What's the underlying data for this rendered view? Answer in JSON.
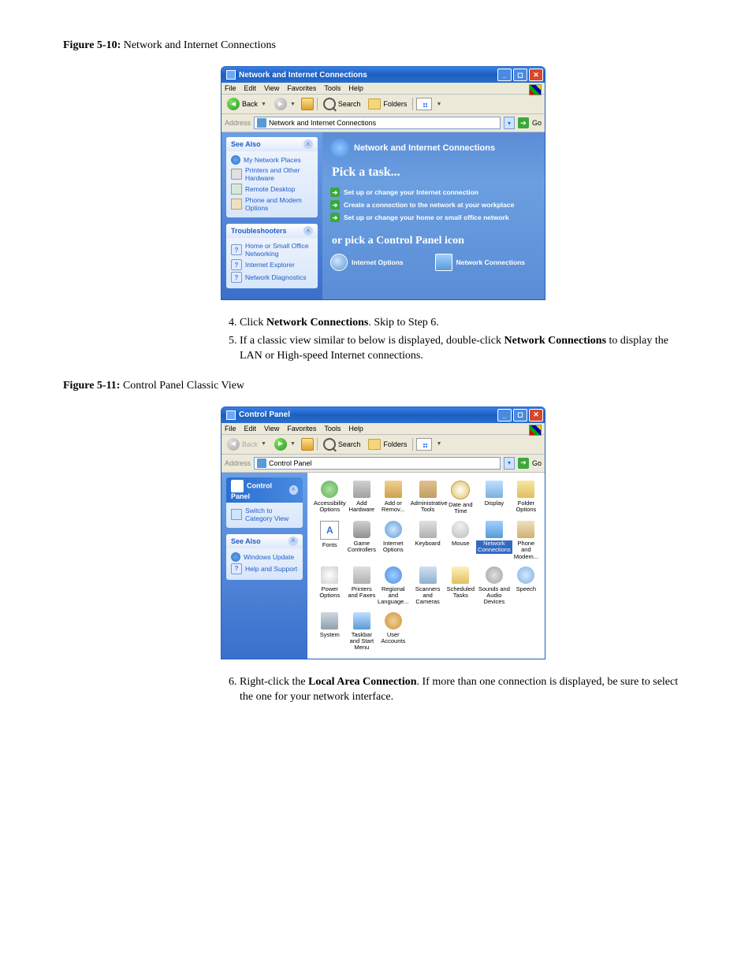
{
  "figure1": {
    "caption_label": "Figure 5-10:",
    "caption_text": " Network and Internet Connections",
    "window_title": "Network and Internet Connections",
    "menu": [
      "File",
      "Edit",
      "View",
      "Favorites",
      "Tools",
      "Help"
    ],
    "toolbar": {
      "back": "Back",
      "search": "Search",
      "folders": "Folders"
    },
    "address": {
      "label": "Address",
      "value": "Network and Internet Connections",
      "go": "Go"
    },
    "side": {
      "see_also": {
        "title": "See Also",
        "items": [
          "My Network Places",
          "Printers and Other Hardware",
          "Remote Desktop",
          "Phone and Modem Options"
        ]
      },
      "troubleshooters": {
        "title": "Troubleshooters",
        "items": [
          "Home or Small Office Networking",
          "Internet Explorer",
          "Network Diagnostics"
        ]
      }
    },
    "main": {
      "category_title": "Network and Internet Connections",
      "pick_task": "Pick a task...",
      "tasks": [
        "Set up or change your Internet connection",
        "Create a connection to the network at your workplace",
        "Set up or change your home or small office network"
      ],
      "or_pick": "or pick a Control Panel icon",
      "icons": [
        "Internet Options",
        "Network Connections"
      ]
    }
  },
  "stepsA": {
    "s4_prefix": "Click ",
    "s4_bold": "Network Connections",
    "s4_suffix": ". Skip to Step 6.",
    "s5_prefix": "If a classic view similar to below is displayed, double-click ",
    "s5_bold": "Network Connections",
    "s5_suffix": " to display the LAN or High-speed Internet connections."
  },
  "figure2": {
    "caption_label": "Figure 5-11:",
    "caption_text": " Control Panel Classic View",
    "window_title": "Control Panel",
    "menu": [
      "File",
      "Edit",
      "View",
      "Favorites",
      "Tools",
      "Help"
    ],
    "toolbar": {
      "back": "Back",
      "search": "Search",
      "folders": "Folders"
    },
    "address": {
      "label": "Address",
      "value": "Control Panel",
      "go": "Go"
    },
    "side": {
      "cp_title": "Control Panel",
      "switch_view": "Switch to Category View",
      "see_also": {
        "title": "See Also",
        "items": [
          "Windows Update",
          "Help and Support"
        ]
      }
    },
    "grid": [
      {
        "label": "Accessibility Options",
        "icon": "bi-acc"
      },
      {
        "label": "Add Hardware",
        "icon": "bi-hw"
      },
      {
        "label": "Add or Remov...",
        "icon": "bi-addrem"
      },
      {
        "label": "Administrative Tools",
        "icon": "bi-admin"
      },
      {
        "label": "Date and Time",
        "icon": "bi-date"
      },
      {
        "label": "Display",
        "icon": "bi-disp"
      },
      {
        "label": "Folder Options",
        "icon": "bi-folder"
      },
      {
        "label": "Fonts",
        "icon": "bi-font"
      },
      {
        "label": "Game Controllers",
        "icon": "bi-game"
      },
      {
        "label": "Internet Options",
        "icon": "bi-ie"
      },
      {
        "label": "Keyboard",
        "icon": "bi-kb"
      },
      {
        "label": "Mouse",
        "icon": "bi-mouse"
      },
      {
        "label": "Network Connections",
        "icon": "bi-net",
        "selected": true
      },
      {
        "label": "Phone and Modem...",
        "icon": "bi-phone"
      },
      {
        "label": "Power Options",
        "icon": "bi-power"
      },
      {
        "label": "Printers and Faxes",
        "icon": "bi-prn"
      },
      {
        "label": "Regional and Language...",
        "icon": "bi-region"
      },
      {
        "label": "Scanners and Cameras",
        "icon": "bi-scan"
      },
      {
        "label": "Scheduled Tasks",
        "icon": "bi-sched"
      },
      {
        "label": "Sounds and Audio Devices",
        "icon": "bi-sound"
      },
      {
        "label": "Speech",
        "icon": "bi-speech"
      },
      {
        "label": "System",
        "icon": "bi-sys"
      },
      {
        "label": "Taskbar and Start Menu",
        "icon": "bi-task"
      },
      {
        "label": "User Accounts",
        "icon": "bi-user"
      }
    ]
  },
  "stepsB": {
    "s6_prefix": "Right-click the ",
    "s6_bold": "Local Area Connection",
    "s6_suffix": ". If more than one connection is displayed, be sure to select the one for your network interface."
  }
}
